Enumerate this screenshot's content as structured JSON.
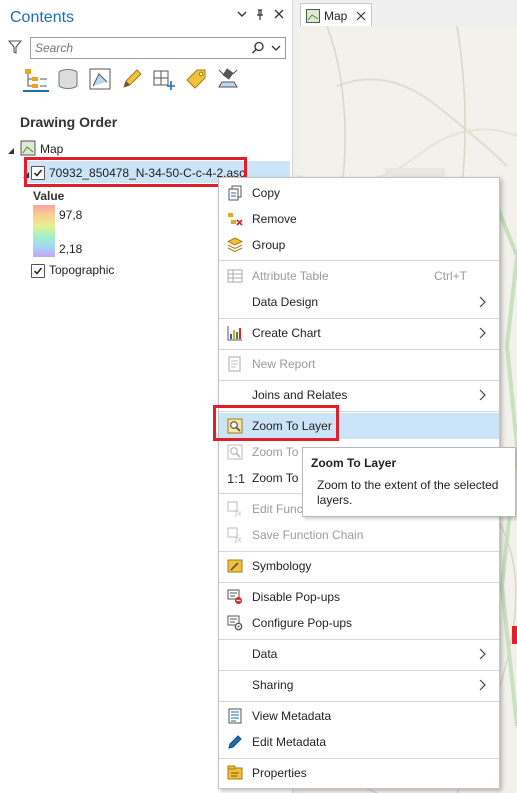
{
  "contents": {
    "title": "Contents",
    "search_placeholder": "Search",
    "drawing_order_label": "Drawing Order",
    "map_item_label": "Map",
    "layer_label": "70932_850478_N-34-50-C-c-4-2.asc",
    "legend_heading": "Value",
    "legend_max": "97,8",
    "legend_min": "2,18",
    "topographic_label": "Topographic"
  },
  "map_tab": {
    "label": "Map"
  },
  "context_menu": {
    "items": [
      {
        "label": "Copy",
        "icon": "copy-icon",
        "enabled": true
      },
      {
        "label": "Remove",
        "icon": "remove-icon",
        "enabled": true
      },
      {
        "label": "Group",
        "icon": "group-icon",
        "enabled": true
      },
      {
        "label": "Attribute Table",
        "icon": "table-icon",
        "enabled": false,
        "shortcut": "Ctrl+T"
      },
      {
        "label": "Data Design",
        "enabled": true,
        "submenu": true
      },
      {
        "label": "Create Chart",
        "icon": "chart-icon",
        "enabled": true,
        "submenu": true
      },
      {
        "label": "New Report",
        "icon": "report-icon",
        "enabled": false
      },
      {
        "label": "Joins and Relates",
        "enabled": true,
        "submenu": true
      },
      {
        "label": "Zoom To Layer",
        "icon": "zoom-layer-icon",
        "enabled": true,
        "highlighted": true
      },
      {
        "label": "Zoom To",
        "icon": "zoom-visible-icon",
        "enabled": false
      },
      {
        "label": "Zoom To",
        "icon": "zoom-source-icon",
        "enabled": true
      },
      {
        "label": "Edit Func",
        "icon": "edit-function-icon",
        "enabled": false
      },
      {
        "label": "Save Function Chain",
        "icon": "save-function-icon",
        "enabled": false
      },
      {
        "label": "Symbology",
        "icon": "symbology-icon",
        "enabled": true
      },
      {
        "label": "Disable Pop-ups",
        "icon": "disable-popups-icon",
        "enabled": true
      },
      {
        "label": "Configure Pop-ups",
        "icon": "configure-popups-icon",
        "enabled": true
      },
      {
        "label": "Data",
        "enabled": true,
        "submenu": true
      },
      {
        "label": "Sharing",
        "enabled": true,
        "submenu": true
      },
      {
        "label": "View Metadata",
        "icon": "view-metadata-icon",
        "enabled": true
      },
      {
        "label": "Edit Metadata",
        "icon": "edit-metadata-icon",
        "enabled": true
      },
      {
        "label": "Properties",
        "icon": "properties-icon",
        "enabled": true
      }
    ]
  },
  "tooltip": {
    "title": "Zoom To Layer",
    "body": "Zoom to the extent of the selected layers."
  },
  "colors": {
    "accent": "#1b6fb5",
    "selection": "#cce4f7",
    "highlight_box": "#e01f2e"
  }
}
